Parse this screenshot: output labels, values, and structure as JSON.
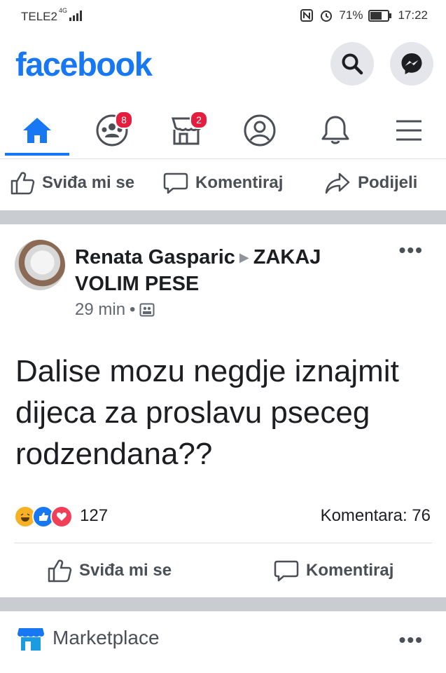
{
  "status_bar": {
    "carrier": "TELE2",
    "network": "4G",
    "battery": "71%",
    "battery_level": 0.71,
    "time": "17:22"
  },
  "header": {
    "logo": "facebook",
    "search_icon": "search-icon",
    "messenger_icon": "messenger-icon"
  },
  "tabs": [
    {
      "icon": "home-icon",
      "active": true,
      "badge": ""
    },
    {
      "icon": "groups-icon",
      "active": false,
      "badge": "8"
    },
    {
      "icon": "marketplace-icon",
      "active": false,
      "badge": "2"
    },
    {
      "icon": "profile-icon",
      "active": false,
      "badge": ""
    },
    {
      "icon": "bell-icon",
      "active": false,
      "badge": ""
    },
    {
      "icon": "menu-icon",
      "active": false,
      "badge": ""
    }
  ],
  "top_actions": {
    "like": "Sviđa mi se",
    "comment": "Komentiraj",
    "share": "Podijeli"
  },
  "post": {
    "author": "Renata Gasparic",
    "group": "ZAKAJ VOLIM PESE",
    "time": "29 min",
    "text": "Dalise mozu negdje iznajmit dijeca za proslavu pseceg rodzendana??",
    "reaction_count": "127",
    "comments": "Komentara: 76",
    "like_label": "Sviđa mi se",
    "comment_label": "Komentiraj"
  },
  "marketplace": {
    "label": "Marketplace"
  },
  "colors": {
    "brand": "#1877f2",
    "badge": "#e41e3f",
    "divider": "#c9ccd1"
  }
}
